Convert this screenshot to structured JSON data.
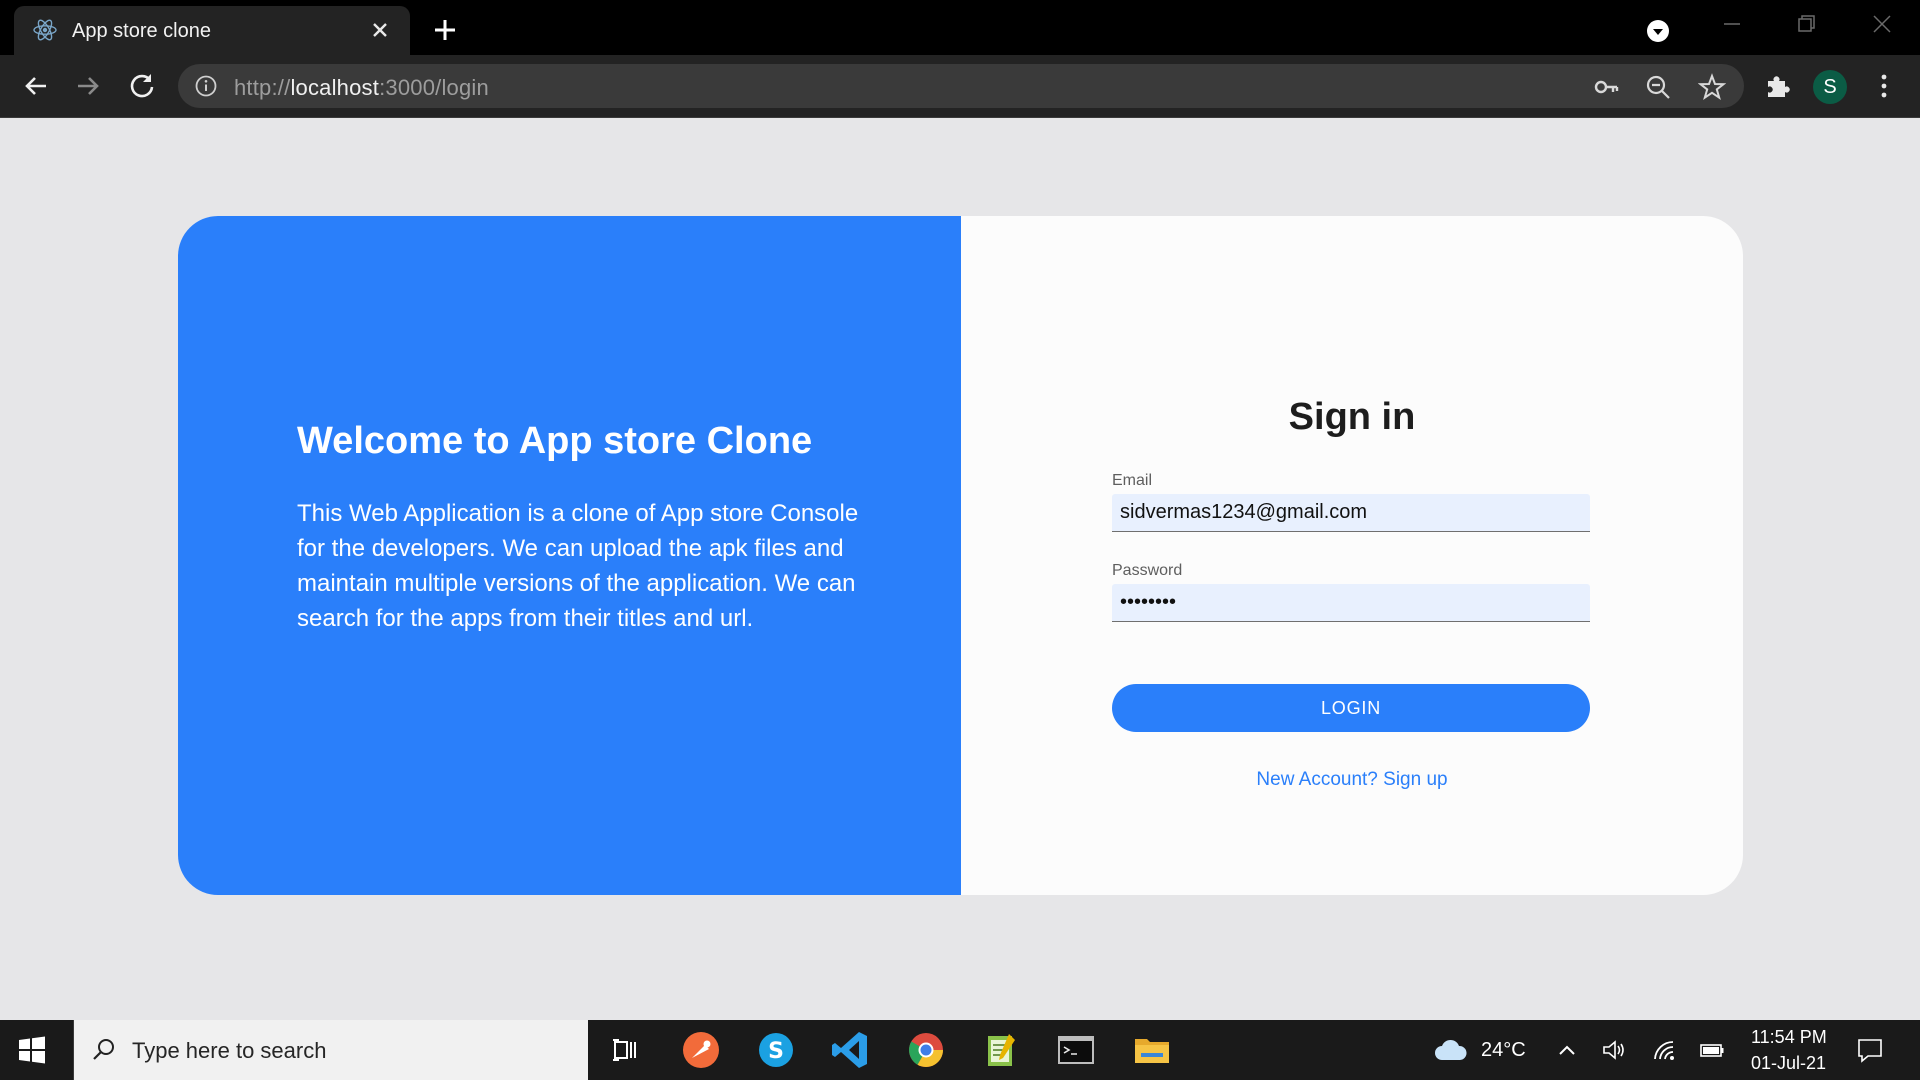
{
  "browser": {
    "tab_title": "App store clone",
    "url_prefix": "http://",
    "url_host": "localhost",
    "url_path": ":3000/login",
    "profile_initial": "S"
  },
  "welcome": {
    "title": "Welcome to App store Clone",
    "text": "This Web Application is a clone of App store Console for the developers. We can upload the apk files and maintain multiple versions of the application. We can search for the apps from their titles and url."
  },
  "signin": {
    "title": "Sign in",
    "email_label": "Email",
    "email_value": "sidvermas1234@gmail.com",
    "password_label": "Password",
    "password_value": "password",
    "login_label": "LOGIN",
    "signup_link": "New Account? Sign up"
  },
  "taskbar": {
    "search_placeholder": "Type here to search",
    "weather": "24°C",
    "time": "11:54 PM",
    "date": "01-Jul-21"
  },
  "colors": {
    "accent": "#2a7ffa",
    "input_bg": "#e8f0fe",
    "page_bg": "#e6e6e8"
  },
  "icons": [
    "react-icon",
    "close-icon",
    "plus-icon",
    "back-arrow-icon",
    "forward-arrow-icon",
    "reload-icon",
    "info-icon",
    "key-icon",
    "zoom-icon",
    "star-icon",
    "puzzle-icon",
    "kebab-menu-icon",
    "windows-icon",
    "search-icon",
    "task-view-icon",
    "postman-icon",
    "skype-icon",
    "vscode-icon",
    "chrome-icon",
    "notepad-icon",
    "terminal-icon",
    "folder-icon",
    "cloud-icon",
    "chevron-up-icon",
    "speaker-icon",
    "wifi-icon",
    "battery-icon",
    "notification-icon"
  ]
}
